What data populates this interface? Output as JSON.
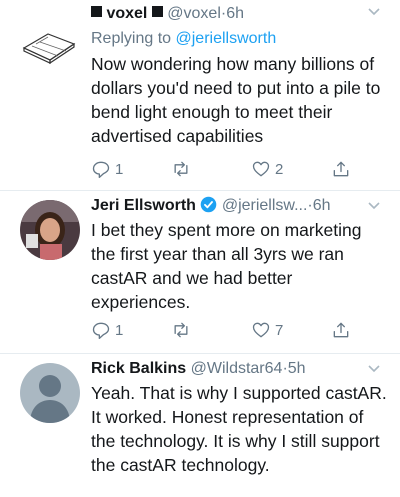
{
  "tweets": [
    {
      "name": "voxel",
      "handle": "@voxel",
      "separator": "·",
      "time": "6h",
      "avatar": "voxel-logo",
      "reply_prefix": "Replying to",
      "reply_handle": "@jeriellsworth",
      "text": "Now wondering how many billions of dollars you'd need to put into a pile to bend light enough to meet their advertised capabilities",
      "reply_count": "1",
      "retweet_count": "",
      "like_count": "2"
    },
    {
      "name": "Jeri Ellsworth",
      "handle": "@jeriellsw...",
      "separator": "·",
      "time": "6h",
      "verified": true,
      "avatar": "photo",
      "text": "I bet they spent more on marketing the first year than all 3yrs we ran castAR and we had better experiences.",
      "reply_count": "1",
      "retweet_count": "",
      "like_count": "7"
    },
    {
      "name": "Rick Balkins",
      "handle": "@Wildstar64",
      "separator": "·",
      "time": "5h",
      "avatar": "default-profile",
      "text": "Yeah. That is why I supported castAR. It worked. Honest representation of the technology. It is why I still support the castAR technology."
    }
  ],
  "colors": {
    "text": "#14171a",
    "muted": "#657786",
    "link": "#1da1f2",
    "divider": "#e6ecf0",
    "avatar_default": "#aab8c2"
  }
}
